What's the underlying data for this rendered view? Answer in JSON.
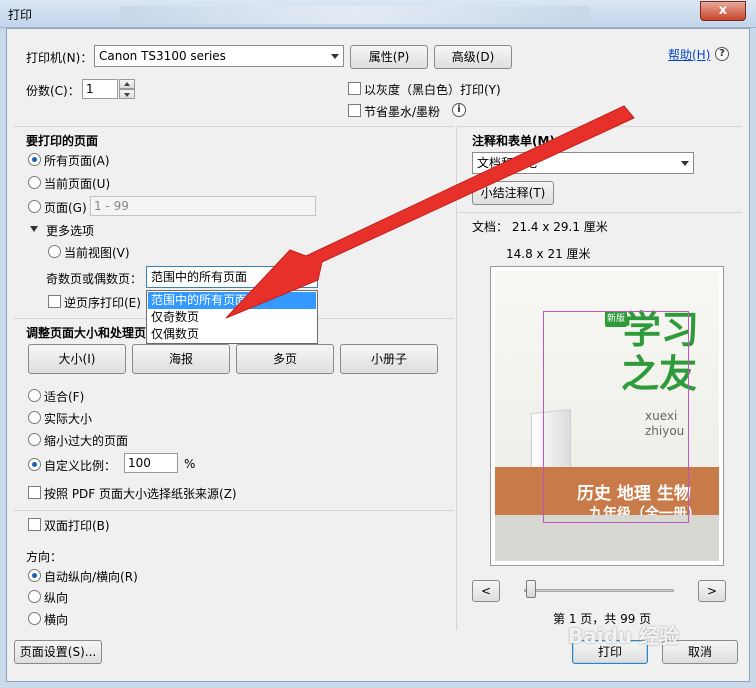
{
  "window": {
    "title": "打印",
    "close_label": "x"
  },
  "printer": {
    "label": "打印机(N)：",
    "selected": "Canon TS3100 series",
    "properties_label": "属性(P)",
    "advanced_label": "高级(D)",
    "help_label": "帮助(H)"
  },
  "copies": {
    "label": "份数(C)：",
    "value": "1"
  },
  "options": {
    "grayscale_label": "以灰度（黑白色）打印(Y)",
    "save_ink_label": "节省墨水/墨粉"
  },
  "pages": {
    "section_title": "要打印的页面",
    "all_label": "所有页面(A)",
    "current_label": "当前页面(U)",
    "pages_label": "页面(G)",
    "pages_range": "1 - 99",
    "more_options_label": "更多选项",
    "current_view_label": "当前视图(V)",
    "odd_even_label": "奇数页或偶数页：",
    "odd_even_selected": "范围中的所有页面",
    "odd_even_options": [
      "范围中的所有页面",
      "仅奇数页",
      "仅偶数页"
    ],
    "reverse_label": "逆页序打印(E)"
  },
  "sizing": {
    "section_title": "调整页面大小和处理页面",
    "size_btn": "大小(I)",
    "poster_btn": "海报",
    "multiple_btn": "多页",
    "booklet_btn": "小册子",
    "fit_label": "适合(F)",
    "actual_label": "实际大小",
    "shrink_label": "缩小过大的页面",
    "custom_label": "自定义比例：",
    "custom_value": "100",
    "percent": "%",
    "pdf_paper_label": "按照 PDF 页面大小选择纸张来源(Z)"
  },
  "duplex": {
    "label": "双面打印(B)"
  },
  "orientation": {
    "title": "方向：",
    "auto_label": "自动纵向/横向(R)",
    "portrait_label": "纵向",
    "landscape_label": "横向"
  },
  "comments": {
    "section_title": "注释和表单(M)",
    "selected": "文档和标记",
    "summarize_label": "小结注释(T)"
  },
  "preview": {
    "doc_size": "文档： 21.4 x 29.1 厘米",
    "paper_size": "14.8 x 21 厘米",
    "page_status": "第 1 页，共 99 页",
    "prev_label": "<",
    "next_label": ">",
    "cover": {
      "title_line1": "学习",
      "title_line2": "之友",
      "badge": "新版",
      "pinyin1": "xuexi",
      "pinyin2": "zhiyou",
      "subject": "历史 地理 生物",
      "grade": "九年级（全一册）"
    }
  },
  "footer": {
    "page_setup_label": "页面设置(S)...",
    "print_label": "打印",
    "cancel_label": "取消"
  },
  "watermark": "Baidu 经验",
  "colors": {
    "accent": "#3399ff",
    "arrow": "#e8302b",
    "cover_green": "#2f9a3a"
  }
}
